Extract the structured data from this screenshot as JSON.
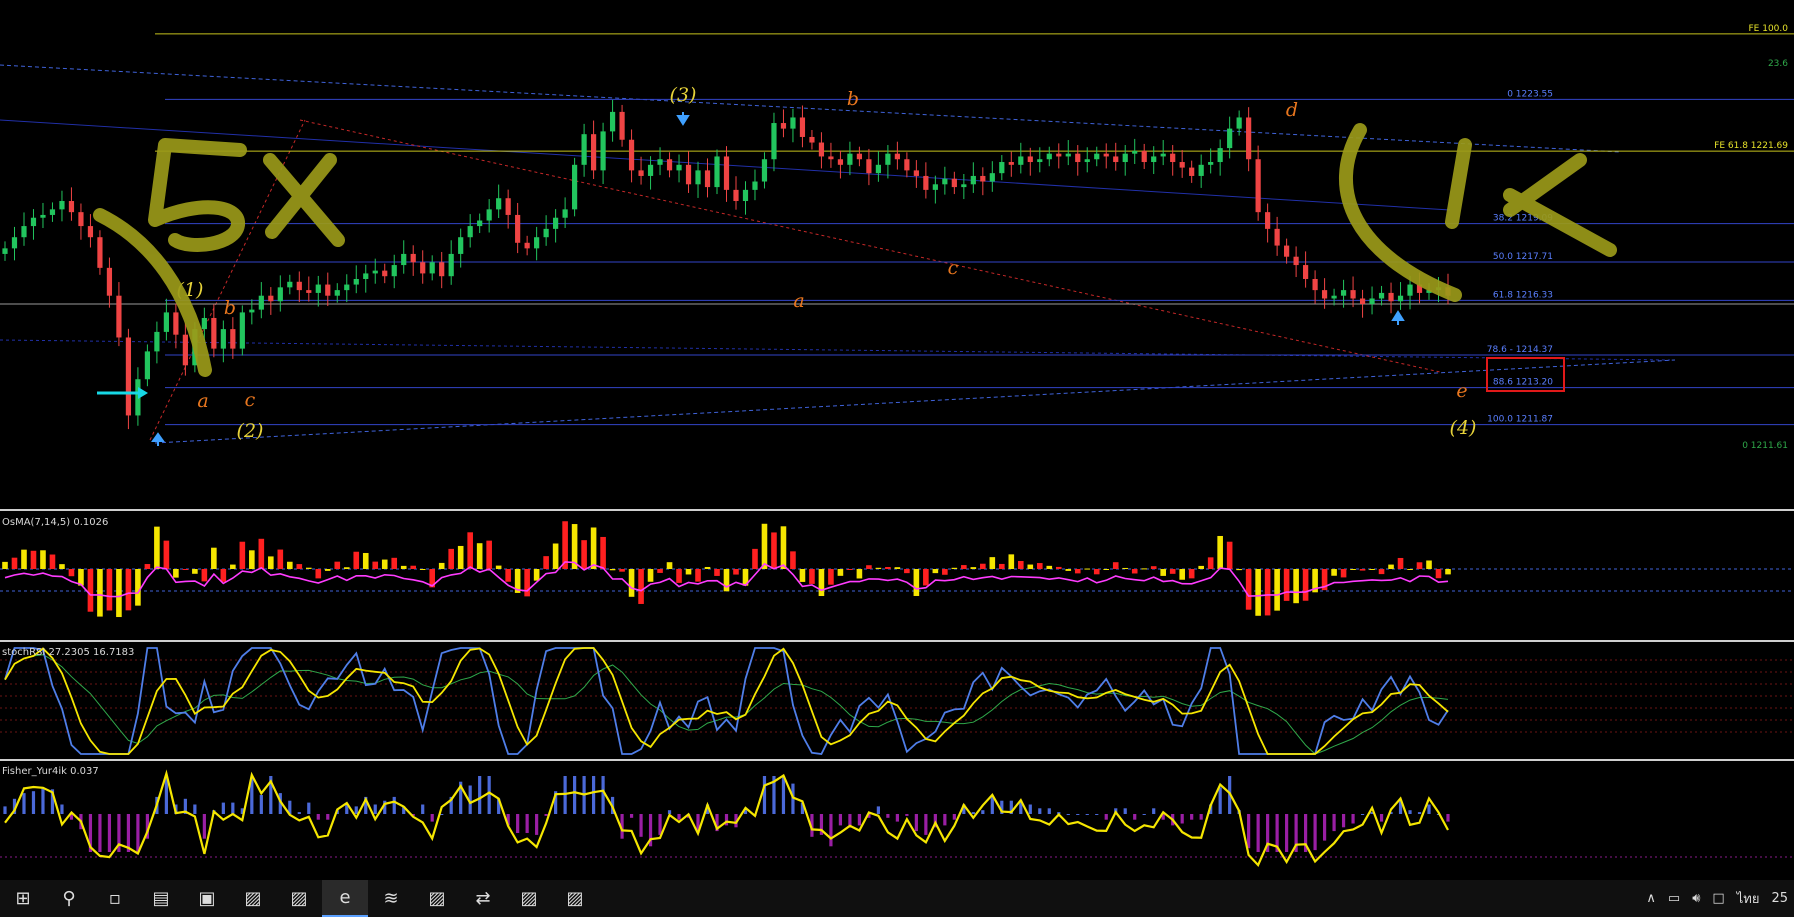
{
  "chart_data": [
    {
      "type": "candlestick",
      "pane": "price",
      "title": "",
      "ylim": [
        1210.6,
        1226.4
      ],
      "fib_levels": [
        {
          "label": "0 1223.55",
          "value": 1223.55
        },
        {
          "label": "38.2 1219.09",
          "value": 1219.09
        },
        {
          "label": "50.0 1217.71",
          "value": 1217.71
        },
        {
          "label": "61.8 1216.33",
          "value": 1216.33
        },
        {
          "label": "78.6 - 1214.37",
          "value": 1214.37
        },
        {
          "label": "88.6 1213.20",
          "value": 1213.2
        },
        {
          "label": "100.0 1211.87",
          "value": 1211.87
        }
      ],
      "fe_levels": [
        {
          "label": "FE 100.0",
          "value": 1225.9
        },
        {
          "label": "FE 61.8 1221.69",
          "value": 1221.69
        }
      ],
      "right_edge_labels": [
        "23.6",
        "0 1211.61"
      ],
      "wave_labels": [
        {
          "text": "(1)",
          "color": "#e6d23a"
        },
        {
          "text": "(2)",
          "color": "#e6d23a"
        },
        {
          "text": "(3)",
          "color": "#e6d23a"
        },
        {
          "text": "(4)",
          "color": "#e6d23a"
        },
        {
          "text": "a",
          "color": "#e8761e"
        },
        {
          "text": "b",
          "color": "#e8761e"
        },
        {
          "text": "c",
          "color": "#e8761e"
        },
        {
          "text": "a",
          "color": "#e8761e"
        },
        {
          "text": "b",
          "color": "#e8761e"
        },
        {
          "text": "c",
          "color": "#e8761e"
        },
        {
          "text": "d",
          "color": "#e8761e"
        },
        {
          "text": "e",
          "color": "#e8761e"
        }
      ],
      "annotations": [
        "5x",
        "1x"
      ],
      "close_series": [
        1218.2,
        1218.6,
        1219.0,
        1219.3,
        1219.4,
        1219.6,
        1219.9,
        1219.5,
        1219.0,
        1218.6,
        1217.5,
        1216.5,
        1215.0,
        1212.2,
        1213.5,
        1214.5,
        1215.2,
        1215.9,
        1215.1,
        1214.0,
        1215.3,
        1215.7,
        1214.6,
        1215.3,
        1214.6,
        1215.9,
        1216.0,
        1216.5,
        1216.3,
        1216.8,
        1217.0,
        1216.7,
        1216.6,
        1216.9,
        1216.5,
        1216.7,
        1216.9,
        1217.1,
        1217.3,
        1217.4,
        1217.2,
        1217.6,
        1218.0,
        1217.7,
        1217.3,
        1217.7,
        1217.2,
        1218.0,
        1218.6,
        1219.0,
        1219.2,
        1219.6,
        1220.0,
        1219.4,
        1218.4,
        1218.2,
        1218.6,
        1218.9,
        1219.3,
        1219.6,
        1221.2,
        1222.3,
        1221.0,
        1222.4,
        1223.1,
        1222.1,
        1221.0,
        1220.8,
        1221.2,
        1221.4,
        1221.0,
        1221.2,
        1220.5,
        1221.0,
        1220.4,
        1221.5,
        1220.3,
        1219.9,
        1220.3,
        1220.6,
        1221.4,
        1222.7,
        1222.5,
        1222.9,
        1222.2,
        1222.0,
        1221.5,
        1221.4,
        1221.2,
        1221.6,
        1221.4,
        1220.9,
        1221.2,
        1221.6,
        1221.4,
        1221.0,
        1220.8,
        1220.3,
        1220.5,
        1220.7,
        1220.4,
        1220.5,
        1220.8,
        1220.6,
        1220.9,
        1221.3,
        1221.2,
        1221.5,
        1221.3,
        1221.4,
        1221.6,
        1221.5,
        1221.6,
        1221.3,
        1221.4,
        1221.6,
        1221.5,
        1221.3,
        1221.6,
        1221.7,
        1221.3,
        1221.5,
        1221.6,
        1221.3,
        1221.1,
        1220.8,
        1221.2,
        1221.3,
        1221.8,
        1222.5,
        1222.9,
        1221.4,
        1219.5,
        1218.9,
        1218.3,
        1217.9,
        1217.6,
        1217.1,
        1216.7,
        1216.4,
        1216.5,
        1216.7,
        1216.4,
        1216.2,
        1216.4,
        1216.6,
        1216.3,
        1216.5,
        1216.9,
        1216.6,
        1216.7,
        1216.8,
        1216.5
      ],
      "bull_color": "#22c55e",
      "bear_color": "#ef4444"
    },
    {
      "type": "histogram",
      "pane": "osma",
      "title": "OsMA(7,14,5) 0.1026",
      "colors": {
        "up": "#f5e600",
        "down": "#ff2020",
        "signal": "#ff3cff"
      }
    },
    {
      "type": "line",
      "pane": "stochrsi",
      "title": "stochRSI 27.2305 16.7183",
      "colors": {
        "main": "#4f7ee8",
        "signal": "#f5e600",
        "ma": "#2fa84a"
      }
    },
    {
      "type": "histogram",
      "pane": "fisher",
      "title": "Fisher_Yur4ik 0.037",
      "colors": {
        "up": "#4b69d8",
        "down": "#9a1fa4",
        "line": "#f5e600"
      }
    }
  ],
  "taskbar": {
    "items": [
      {
        "name": "start-button",
        "icon": "⊞",
        "active": false
      },
      {
        "name": "search-button",
        "icon": "⚲",
        "active": false
      },
      {
        "name": "task-view-button",
        "icon": "▫",
        "active": false
      },
      {
        "name": "file-explorer-icon",
        "icon": "▤",
        "active": false
      },
      {
        "name": "store-icon",
        "icon": "▣",
        "active": false
      },
      {
        "name": "metatrader-icon-1",
        "icon": "▨",
        "active": false
      },
      {
        "name": "metatrader-icon-2",
        "icon": "▨",
        "active": false
      },
      {
        "name": "edge-browser-icon",
        "icon": "e",
        "active": true
      },
      {
        "name": "trading-app-icon",
        "icon": "≋",
        "active": false
      },
      {
        "name": "metatrader-icon-3",
        "icon": "▨",
        "active": false
      },
      {
        "name": "teamviewer-icon",
        "icon": "⇄",
        "active": false
      },
      {
        "name": "metatrader-icon-4",
        "icon": "▨",
        "active": false
      },
      {
        "name": "metatrader-icon-5",
        "icon": "▨",
        "active": false
      }
    ],
    "tray": {
      "language": "ไทย",
      "clock": "25"
    }
  }
}
